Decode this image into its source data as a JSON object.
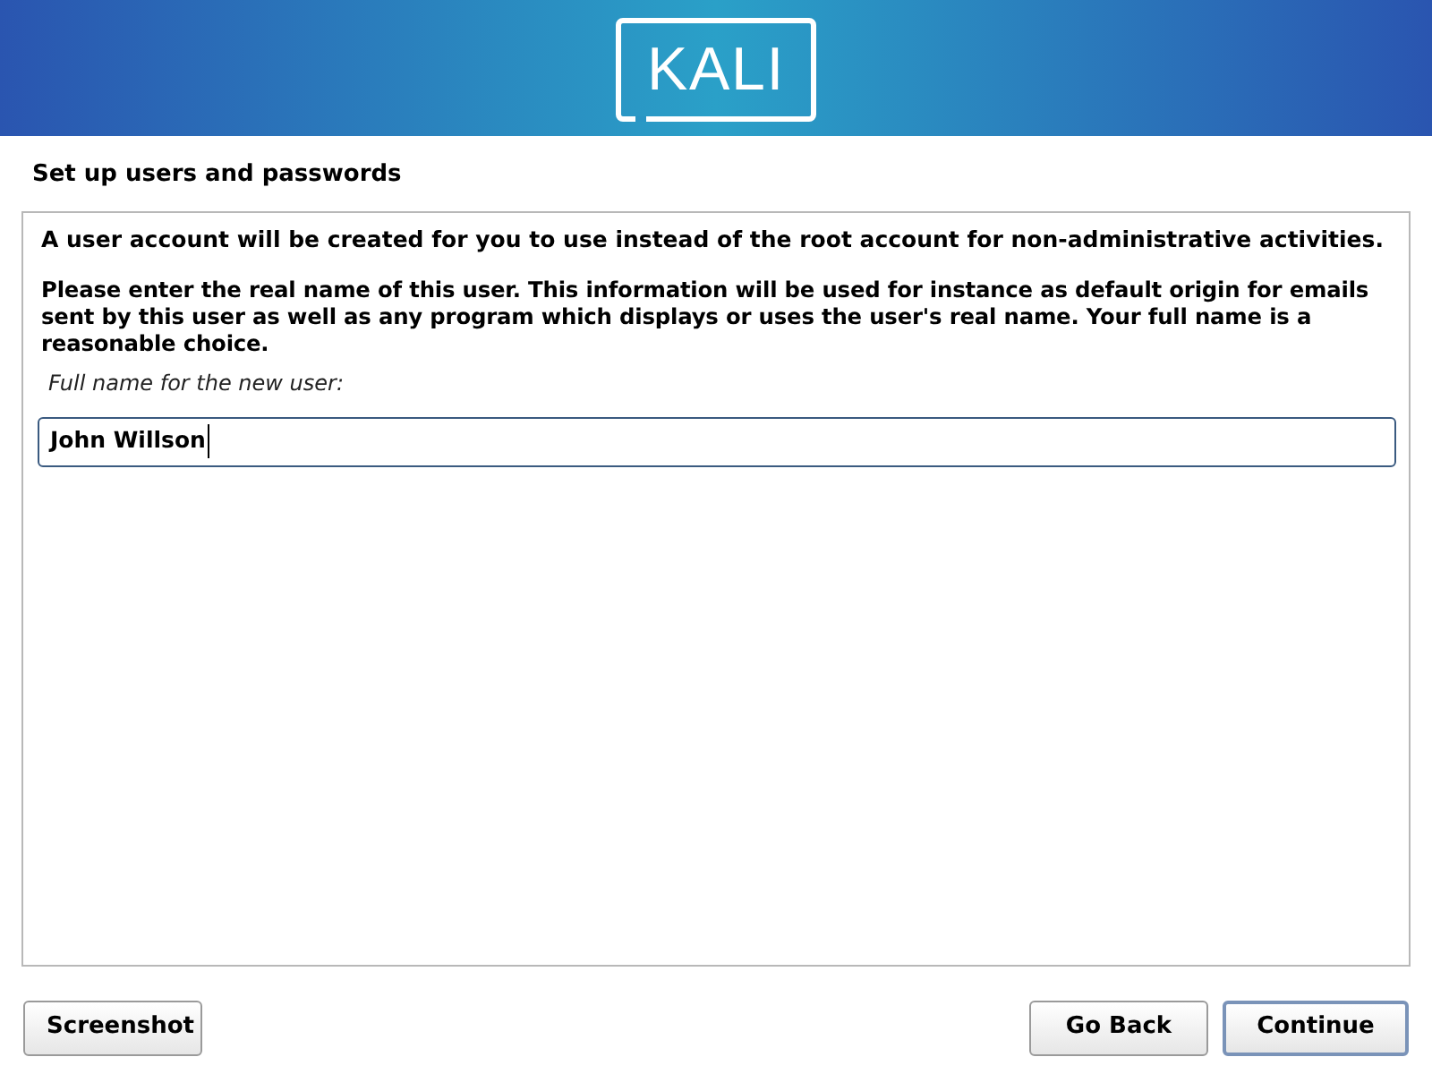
{
  "banner": {
    "logo": "KALI"
  },
  "step_title": "Set up users and passwords",
  "panel": {
    "intro": "A user account will be created for you to use instead of the root account for non-administrative activities.",
    "description": "Please enter the real name of this user. This information will be used for instance as default origin for emails sent by this user as well as any program which displays or uses the user's real name. Your full name is a reasonable choice.",
    "field_label": "Full name for the new user:",
    "field_value": "John Willson"
  },
  "left_buttons": [
    {
      "label": "Screenshot",
      "focused": false
    }
  ],
  "right_buttons": [
    {
      "label": "Go Back",
      "focused": false
    },
    {
      "label": "Continue",
      "focused": true
    }
  ]
}
